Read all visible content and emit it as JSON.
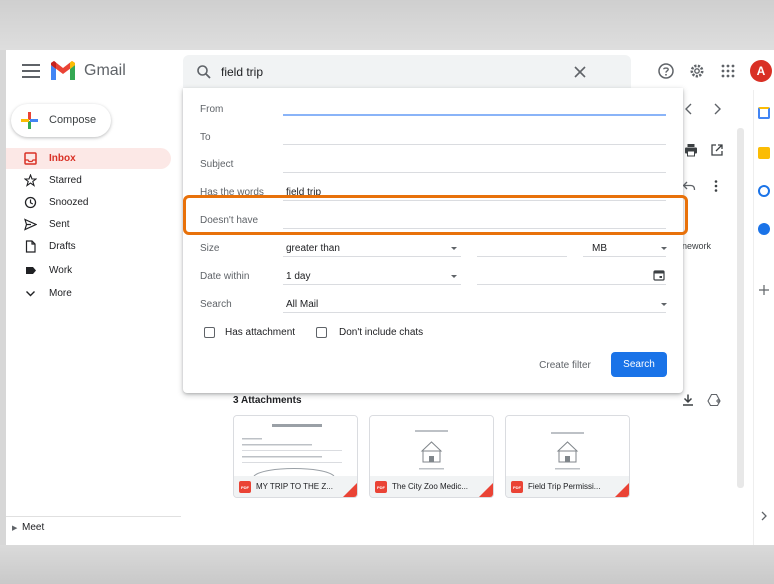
{
  "app": {
    "title": "Gmail",
    "avatar_letter": "A",
    "brand_colors": {
      "red": "#ea4335",
      "blue": "#4285f4",
      "green": "#34a853",
      "yellow": "#fbbc04",
      "highlight": "#e8710a",
      "primary": "#1a73e8"
    }
  },
  "search": {
    "query": "field trip"
  },
  "sidebar": {
    "compose_label": "Compose",
    "items": [
      {
        "label": "Inbox",
        "icon": "inbox-icon",
        "active": true
      },
      {
        "label": "Starred",
        "icon": "star-icon"
      },
      {
        "label": "Snoozed",
        "icon": "clock-icon"
      },
      {
        "label": "Sent",
        "icon": "send-icon"
      },
      {
        "label": "Drafts",
        "icon": "file-icon"
      },
      {
        "label": "Work",
        "icon": "label-icon"
      },
      {
        "label": "More",
        "icon": "chevron-down-icon"
      }
    ],
    "meet_label": "Meet"
  },
  "advanced_search": {
    "from_label": "From",
    "to_label": "To",
    "subject_label": "Subject",
    "has_words_label": "Has the words",
    "has_words_value": "field trip",
    "doesnt_have_label": "Doesn't have",
    "size_label": "Size",
    "size_op": "greater than",
    "size_unit": "MB",
    "date_within_label": "Date within",
    "date_within_value": "1 day",
    "search_label": "Search",
    "search_scope": "All Mail",
    "has_attachment_label": "Has attachment",
    "dont_include_chats_label": "Don't include chats",
    "create_filter_label": "Create filter",
    "search_button_label": "Search"
  },
  "email": {
    "peek_text": "nework",
    "attachments_title": "3 Attachments",
    "attachments": [
      {
        "name": "MY TRIP TO THE Z..."
      },
      {
        "name": "The City Zoo Medic..."
      },
      {
        "name": "Field Trip Permissi..."
      }
    ]
  }
}
